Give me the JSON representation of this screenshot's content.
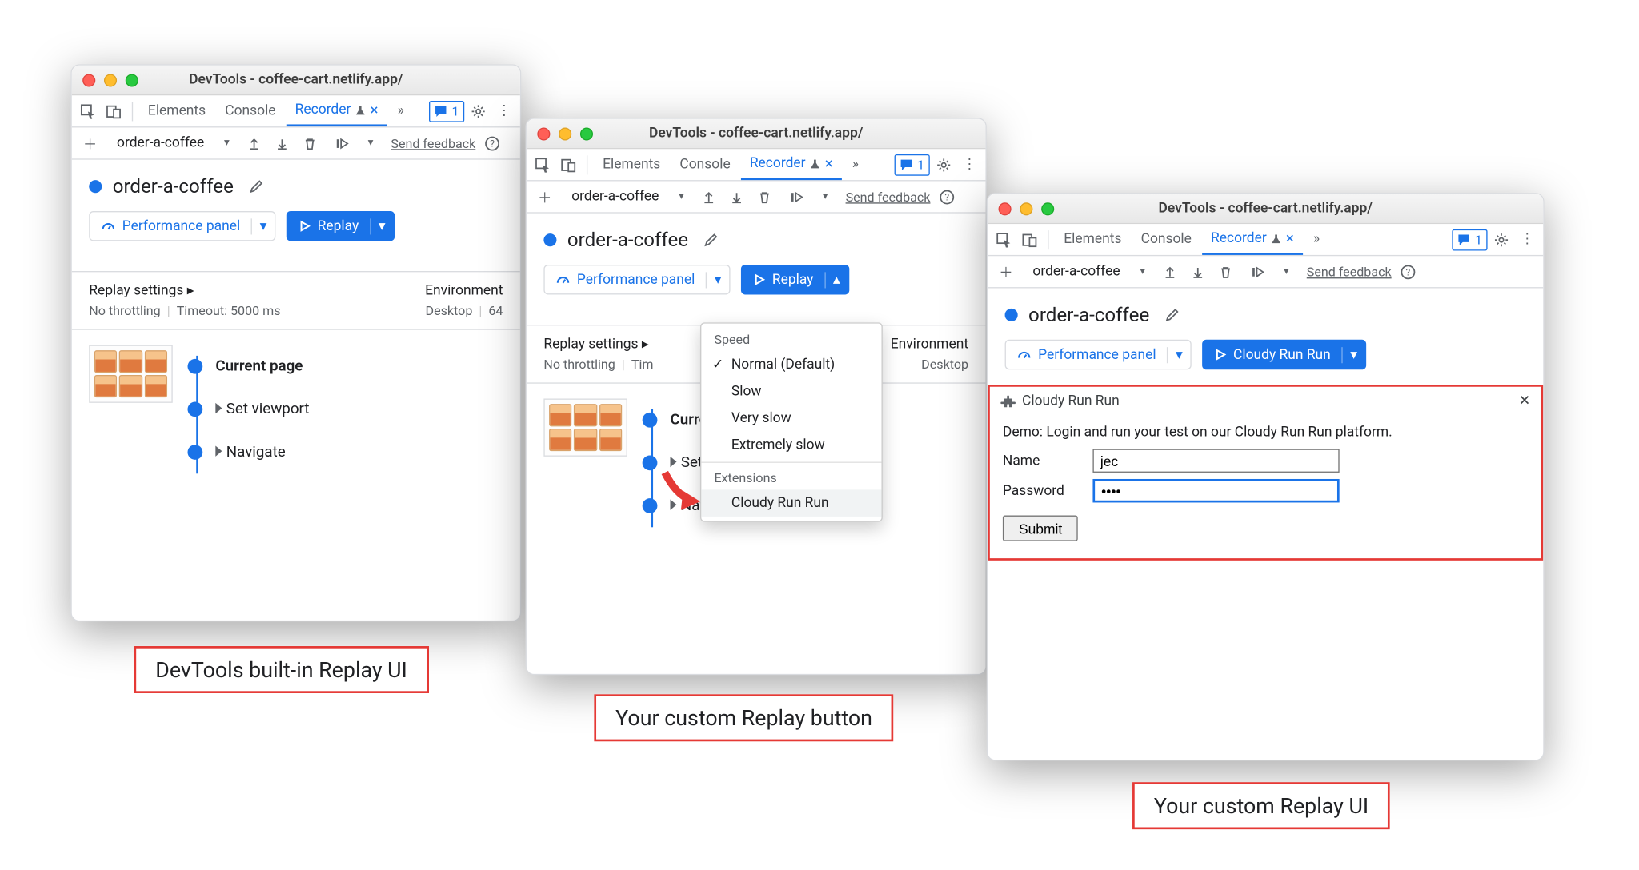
{
  "title": "DevTools - coffee-cart.netlify.app/",
  "tabs": {
    "elements": "Elements",
    "console": "Console",
    "recorder": "Recorder"
  },
  "issues_badge": "1",
  "recording_name": "order-a-coffee",
  "feedback": "Send feedback",
  "perf_btn": "Performance panel",
  "replay_btn": "Replay",
  "cloudy_btn": "Cloudy Run Run",
  "replay_settings": "Replay settings",
  "throttling": "No throttling",
  "timeout": "Timeout: 5000 ms",
  "environment": "Environment",
  "env_desktop": "Desktop",
  "env_64": "64",
  "steps": {
    "current": "Current page",
    "viewport": "Set viewport",
    "navigate": "Navigate"
  },
  "menu": {
    "speed": "Speed",
    "normal": "Normal (Default)",
    "slow": "Slow",
    "veryslow": "Very slow",
    "extslow": "Extremely slow",
    "extensions": "Extensions",
    "cloudy": "Cloudy Run Run"
  },
  "panel": {
    "title": "Cloudy Run Run",
    "desc": "Demo: Login and run your test on our Cloudy Run Run platform.",
    "name_label": "Name",
    "name_value": "jec",
    "pass_label": "Password",
    "pass_value": "••••",
    "submit": "Submit"
  },
  "captions": {
    "a": "DevTools built-in Replay UI",
    "b": "Your custom Replay button",
    "c": "Your custom Replay UI"
  }
}
